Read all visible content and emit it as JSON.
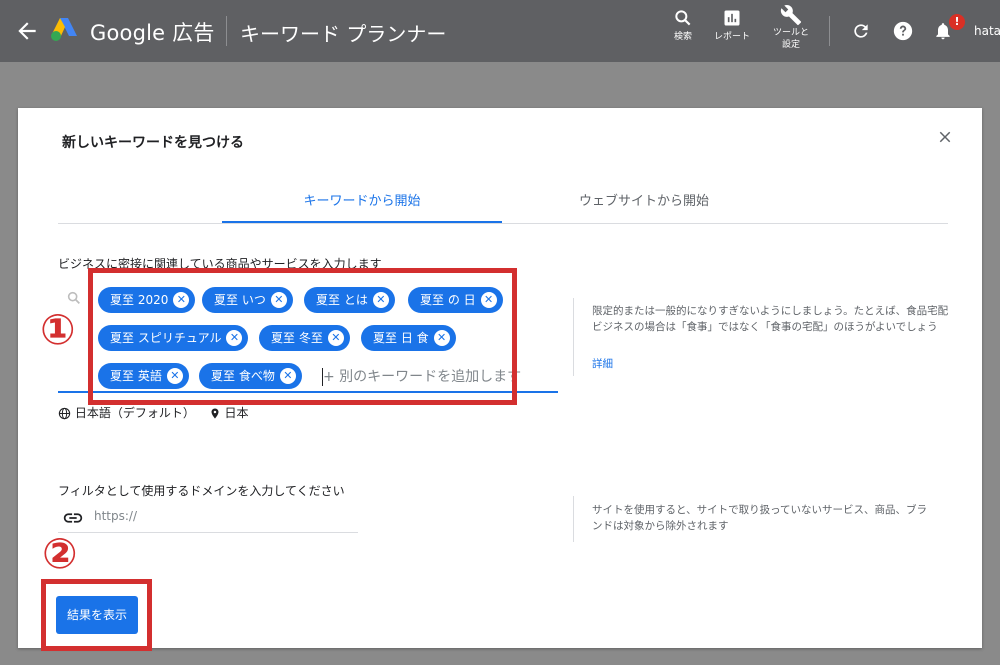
{
  "topbar": {
    "brand": "Google 広告",
    "page_title": "キーワード プランナー",
    "buttons": [
      {
        "label": "検索",
        "icon": "search-icon"
      },
      {
        "label": "レポート",
        "icon": "bar-chart-icon"
      },
      {
        "label": "ツールと",
        "label2": "設定",
        "icon": "wrench-icon"
      }
    ],
    "notification_count": "!",
    "user": "hatan"
  },
  "card": {
    "title": "新しいキーワードを見つける",
    "tabs": [
      "キーワードから開始",
      "ウェブサイトから開始"
    ],
    "active_tab": 0,
    "keyword_prompt": "ビジネスに密接に関連している商品やサービスを入力します",
    "keywords": [
      "夏至 2020",
      "夏至 いつ",
      "夏至 とは",
      "夏至 の 日",
      "夏至 スピリチュアル",
      "夏至 冬至",
      "夏至 日 食",
      "夏至 英語",
      "夏至 食べ物"
    ],
    "keyword_placeholder": "+ 別のキーワードを追加します",
    "keyword_hint": "限定的または一般的になりすぎないようにしましょう。たとえば、食品宅配ビジネスの場合は「食事」ではなく「食事の宅配」のほうがよいでしょう",
    "detail_link": "詳細",
    "language": "日本語（デフォルト）",
    "location": "日本",
    "domain_label": "フィルタとして使用するドメインを入力してください",
    "domain_placeholder": "https://",
    "domain_hint": "サイトを使用すると、サイトで取り扱っていないサービス、商品、ブランドは対象から除外されます",
    "submit_label": "結果を表示"
  },
  "annotations": {
    "step1": "①",
    "step2": "②",
    "color": "#d32f2f"
  },
  "colors": {
    "topbar": "#5f6063",
    "accent": "#1a73e8"
  }
}
